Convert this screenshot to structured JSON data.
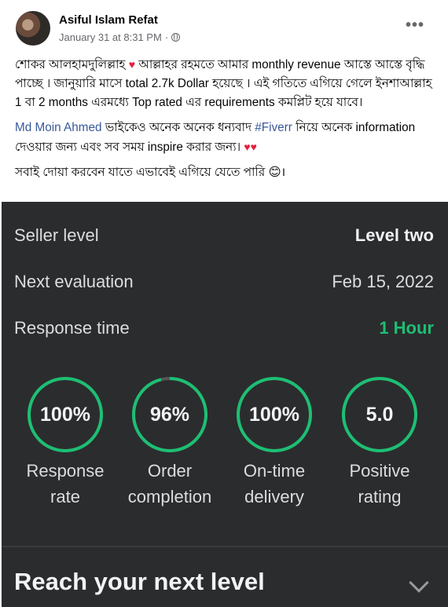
{
  "post": {
    "author": "Asiful Islam Refat",
    "timestamp": "January 31 at 8:31 PM",
    "separator": "·",
    "more_label": "•••",
    "paragraph1_part1": "শোকর আলহামদুলিল্লাহ ",
    "heart": "♥",
    "paragraph1_part2": " আল্লাহর রহমতে আমার monthly revenue আস্তে আস্তে বৃদ্ধি পাচ্ছে । জানুয়ারি মাসে total 2.7k Dollar  হয়েছে । এই গতিতে এগিয়ে গেলে ইনশাআল্লাহ 1 বা 2 months এরমধ্যে Top rated এর requirements কমপ্লিট হয়ে যাবে।",
    "mention": "Md Moin Ahmed",
    "paragraph2_part1": "  ভাইকেও অনেক অনেক ধন্যবাদ ",
    "hashtag": "#Fiverr",
    "paragraph2_part2": "  নিয়ে অনেক information দেওয়ার জন্য  এবং সব সময় inspire করার জন্য। ",
    "hearts": "♥♥",
    "paragraph3_part1": "সবাই দোয়া করবেন যাতে এভাবেই এগিয়ে যেতে পারি ",
    "emoji": "😊",
    "paragraph3_part2": "।"
  },
  "screenshot": {
    "rows": [
      {
        "label": "Seller level",
        "value": "Level two"
      },
      {
        "label": "Next evaluation",
        "value": "Feb 15, 2022"
      },
      {
        "label": "Response time",
        "value": "1 Hour"
      }
    ],
    "stats": [
      {
        "value": "100%",
        "caption1": "Response",
        "caption2": "rate",
        "fraction": 1.0
      },
      {
        "value": "96%",
        "caption1": "Order",
        "caption2": "completion",
        "fraction": 0.96
      },
      {
        "value": "100%",
        "caption1": "On-time",
        "caption2": "delivery",
        "fraction": 1.0
      },
      {
        "value": "5.0",
        "caption1": "Positive",
        "caption2": "rating",
        "fraction": 1.0
      }
    ],
    "reach_title": "Reach your next level",
    "colors": {
      "accent_green": "#1dbf73",
      "panel_bg": "#2b2c2e",
      "ring_track": "#55565a"
    }
  }
}
